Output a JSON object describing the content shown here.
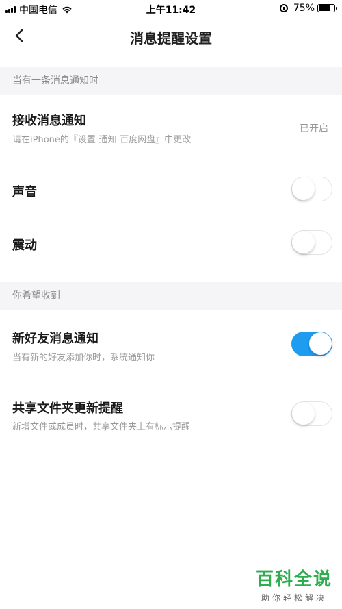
{
  "status_bar": {
    "carrier": "中国电信",
    "time": "上午11:42",
    "battery": "75%",
    "battery_level": 0.75
  },
  "nav": {
    "title": "消息提醒设置",
    "back_icon": "chevron-left-icon"
  },
  "section1": {
    "header": "当有一条消息通知时",
    "receive": {
      "title": "接收消息通知",
      "subtitle": "请在iPhone的『设置-通知-百度网盘』中更改",
      "status": "已开启"
    },
    "sound": {
      "title": "声音",
      "enabled": false
    },
    "vibrate": {
      "title": "震动",
      "enabled": false
    }
  },
  "section2": {
    "header": "你希望收到",
    "new_friend": {
      "title": "新好友消息通知",
      "subtitle": "当有新的好友添加你时，系统通知你",
      "enabled": true
    },
    "shared_folder": {
      "title": "共享文件夹更新提醒",
      "subtitle": "新增文件或成员时，共享文件夹上有标示提醒",
      "enabled": false
    }
  },
  "colors": {
    "toggle_on": "#1e9cf0",
    "section_bg": "#f5f5f7",
    "watermark": "#2eac4f"
  },
  "watermark": {
    "main": "百科全说",
    "sub": "助你轻松解决"
  }
}
